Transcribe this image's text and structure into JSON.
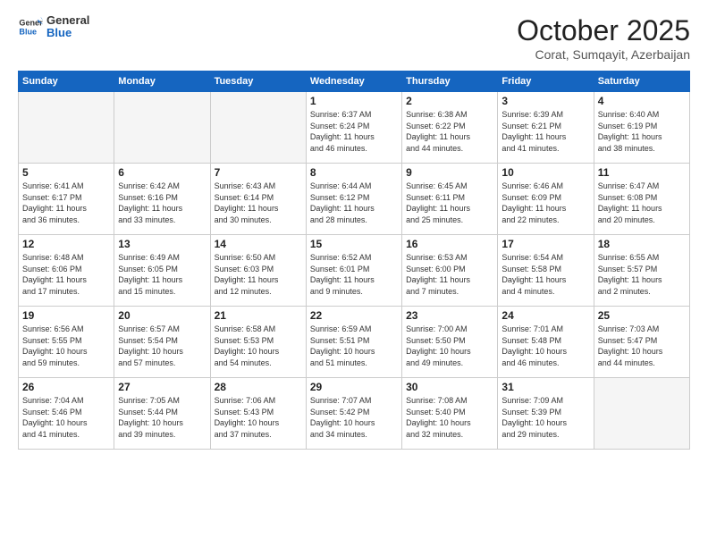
{
  "logo": {
    "line1": "General",
    "line2": "Blue"
  },
  "header": {
    "month": "October 2025",
    "location": "Corat, Sumqayit, Azerbaijan"
  },
  "weekdays": [
    "Sunday",
    "Monday",
    "Tuesday",
    "Wednesday",
    "Thursday",
    "Friday",
    "Saturday"
  ],
  "weeks": [
    [
      {
        "day": "",
        "info": ""
      },
      {
        "day": "",
        "info": ""
      },
      {
        "day": "",
        "info": ""
      },
      {
        "day": "1",
        "info": "Sunrise: 6:37 AM\nSunset: 6:24 PM\nDaylight: 11 hours\nand 46 minutes."
      },
      {
        "day": "2",
        "info": "Sunrise: 6:38 AM\nSunset: 6:22 PM\nDaylight: 11 hours\nand 44 minutes."
      },
      {
        "day": "3",
        "info": "Sunrise: 6:39 AM\nSunset: 6:21 PM\nDaylight: 11 hours\nand 41 minutes."
      },
      {
        "day": "4",
        "info": "Sunrise: 6:40 AM\nSunset: 6:19 PM\nDaylight: 11 hours\nand 38 minutes."
      }
    ],
    [
      {
        "day": "5",
        "info": "Sunrise: 6:41 AM\nSunset: 6:17 PM\nDaylight: 11 hours\nand 36 minutes."
      },
      {
        "day": "6",
        "info": "Sunrise: 6:42 AM\nSunset: 6:16 PM\nDaylight: 11 hours\nand 33 minutes."
      },
      {
        "day": "7",
        "info": "Sunrise: 6:43 AM\nSunset: 6:14 PM\nDaylight: 11 hours\nand 30 minutes."
      },
      {
        "day": "8",
        "info": "Sunrise: 6:44 AM\nSunset: 6:12 PM\nDaylight: 11 hours\nand 28 minutes."
      },
      {
        "day": "9",
        "info": "Sunrise: 6:45 AM\nSunset: 6:11 PM\nDaylight: 11 hours\nand 25 minutes."
      },
      {
        "day": "10",
        "info": "Sunrise: 6:46 AM\nSunset: 6:09 PM\nDaylight: 11 hours\nand 22 minutes."
      },
      {
        "day": "11",
        "info": "Sunrise: 6:47 AM\nSunset: 6:08 PM\nDaylight: 11 hours\nand 20 minutes."
      }
    ],
    [
      {
        "day": "12",
        "info": "Sunrise: 6:48 AM\nSunset: 6:06 PM\nDaylight: 11 hours\nand 17 minutes."
      },
      {
        "day": "13",
        "info": "Sunrise: 6:49 AM\nSunset: 6:05 PM\nDaylight: 11 hours\nand 15 minutes."
      },
      {
        "day": "14",
        "info": "Sunrise: 6:50 AM\nSunset: 6:03 PM\nDaylight: 11 hours\nand 12 minutes."
      },
      {
        "day": "15",
        "info": "Sunrise: 6:52 AM\nSunset: 6:01 PM\nDaylight: 11 hours\nand 9 minutes."
      },
      {
        "day": "16",
        "info": "Sunrise: 6:53 AM\nSunset: 6:00 PM\nDaylight: 11 hours\nand 7 minutes."
      },
      {
        "day": "17",
        "info": "Sunrise: 6:54 AM\nSunset: 5:58 PM\nDaylight: 11 hours\nand 4 minutes."
      },
      {
        "day": "18",
        "info": "Sunrise: 6:55 AM\nSunset: 5:57 PM\nDaylight: 11 hours\nand 2 minutes."
      }
    ],
    [
      {
        "day": "19",
        "info": "Sunrise: 6:56 AM\nSunset: 5:55 PM\nDaylight: 10 hours\nand 59 minutes."
      },
      {
        "day": "20",
        "info": "Sunrise: 6:57 AM\nSunset: 5:54 PM\nDaylight: 10 hours\nand 57 minutes."
      },
      {
        "day": "21",
        "info": "Sunrise: 6:58 AM\nSunset: 5:53 PM\nDaylight: 10 hours\nand 54 minutes."
      },
      {
        "day": "22",
        "info": "Sunrise: 6:59 AM\nSunset: 5:51 PM\nDaylight: 10 hours\nand 51 minutes."
      },
      {
        "day": "23",
        "info": "Sunrise: 7:00 AM\nSunset: 5:50 PM\nDaylight: 10 hours\nand 49 minutes."
      },
      {
        "day": "24",
        "info": "Sunrise: 7:01 AM\nSunset: 5:48 PM\nDaylight: 10 hours\nand 46 minutes."
      },
      {
        "day": "25",
        "info": "Sunrise: 7:03 AM\nSunset: 5:47 PM\nDaylight: 10 hours\nand 44 minutes."
      }
    ],
    [
      {
        "day": "26",
        "info": "Sunrise: 7:04 AM\nSunset: 5:46 PM\nDaylight: 10 hours\nand 41 minutes."
      },
      {
        "day": "27",
        "info": "Sunrise: 7:05 AM\nSunset: 5:44 PM\nDaylight: 10 hours\nand 39 minutes."
      },
      {
        "day": "28",
        "info": "Sunrise: 7:06 AM\nSunset: 5:43 PM\nDaylight: 10 hours\nand 37 minutes."
      },
      {
        "day": "29",
        "info": "Sunrise: 7:07 AM\nSunset: 5:42 PM\nDaylight: 10 hours\nand 34 minutes."
      },
      {
        "day": "30",
        "info": "Sunrise: 7:08 AM\nSunset: 5:40 PM\nDaylight: 10 hours\nand 32 minutes."
      },
      {
        "day": "31",
        "info": "Sunrise: 7:09 AM\nSunset: 5:39 PM\nDaylight: 10 hours\nand 29 minutes."
      },
      {
        "day": "",
        "info": ""
      }
    ]
  ]
}
